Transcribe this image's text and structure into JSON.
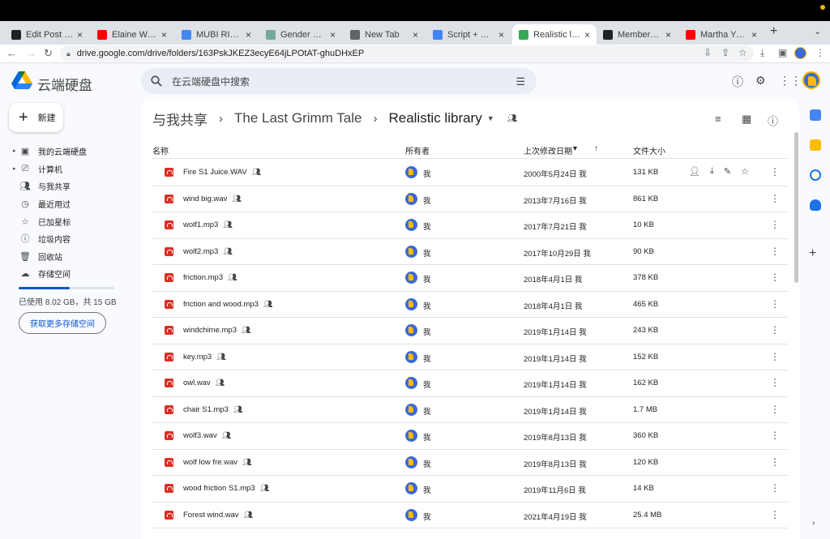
{
  "browser": {
    "tabs": [
      {
        "label": "Edit Post *AR Ti",
        "favicon": "black-square-icon",
        "color": "#202124"
      },
      {
        "label": "Elaine Wah - Yo",
        "favicon": "youtube-icon",
        "color": "#ff0000"
      },
      {
        "label": "MUBI RIDING Hi",
        "favicon": "google-icon",
        "color": "#4285f4"
      },
      {
        "label": "Gender Dynami",
        "favicon": "chatgpt-icon",
        "color": "#74aa9c"
      },
      {
        "label": "New Tab",
        "favicon": "chrome-icon",
        "color": "#5f6368"
      },
      {
        "label": "Script + Sound",
        "favicon": "docs-icon",
        "color": "#4285f4"
      },
      {
        "label": "Realistic library",
        "favicon": "drive-icon",
        "color": "#34a853"
      },
      {
        "label": "Members – myt",
        "favicon": "black-square-icon",
        "color": "#202124"
      },
      {
        "label": "Martha Yuill - Yo",
        "favicon": "youtube-icon",
        "color": "#ff0000"
      }
    ],
    "url": "drive.google.com/drive/folders/163PskJKEZ3ecyE64jLPOtAT-ghuDHxEP"
  },
  "header": {
    "brand": "云端硬盘",
    "search_placeholder": "在云端硬盘中搜索"
  },
  "sidebar": {
    "new_label": "新建",
    "items": [
      {
        "label": "我的云端硬盘",
        "icon": "my-drive-icon",
        "expandable": true
      },
      {
        "label": "计算机",
        "icon": "computer-icon",
        "expandable": true
      },
      {
        "label": "与我共享",
        "icon": "shared-with-me-icon",
        "expandable": false
      },
      {
        "label": "最近用过",
        "icon": "recent-icon",
        "expandable": false
      },
      {
        "label": "已加星标",
        "icon": "star-icon",
        "expandable": false
      },
      {
        "label": "垃圾内容",
        "icon": "spam-icon",
        "expandable": false
      },
      {
        "label": "回收站",
        "icon": "trash-icon",
        "expandable": false
      },
      {
        "label": "存储空间",
        "icon": "cloud-icon",
        "expandable": false
      }
    ],
    "storage_text": "已使用 8.02 GB，共 15 GB",
    "storage_fraction": 0.535,
    "get_more_label": "获取更多存储空间"
  },
  "breadcrumb": {
    "items": [
      "与我共享",
      "The Last Grimm Tale",
      "Realistic library"
    ]
  },
  "table": {
    "headers": {
      "name": "名称",
      "owner": "所有者",
      "modified": "上次修改日期",
      "size": "文件大小"
    },
    "rows": [
      {
        "name": "Fire S1 Juice.WAV",
        "owner": "我",
        "modified": "2000年5月24日 我",
        "size": "131 KB"
      },
      {
        "name": "wind big.wav",
        "owner": "我",
        "modified": "2013年7月16日 我",
        "size": "861 KB"
      },
      {
        "name": "wolf1.mp3",
        "owner": "我",
        "modified": "2017年7月21日 我",
        "size": "10 KB"
      },
      {
        "name": "wolf2.mp3",
        "owner": "我",
        "modified": "2017年10月29日 我",
        "size": "90 KB"
      },
      {
        "name": "friction.mp3",
        "owner": "我",
        "modified": "2018年4月1日 我",
        "size": "378 KB"
      },
      {
        "name": "friction and wood.mp3",
        "owner": "我",
        "modified": "2018年4月1日 我",
        "size": "465 KB"
      },
      {
        "name": "windchime.mp3",
        "owner": "我",
        "modified": "2019年1月14日 我",
        "size": "243 KB"
      },
      {
        "name": "key.mp3",
        "owner": "我",
        "modified": "2019年1月14日 我",
        "size": "152 KB"
      },
      {
        "name": "owl.wav",
        "owner": "我",
        "modified": "2019年1月14日 我",
        "size": "162 KB"
      },
      {
        "name": "chair S1.mp3",
        "owner": "我",
        "modified": "2019年1月14日 我",
        "size": "1.7 MB"
      },
      {
        "name": "wolf3.wav",
        "owner": "我",
        "modified": "2019年8月13日 我",
        "size": "360 KB"
      },
      {
        "name": "wolf low fre.wav",
        "owner": "我",
        "modified": "2019年8月13日 我",
        "size": "120 KB"
      },
      {
        "name": "wood friction S1.mp3",
        "owner": "我",
        "modified": "2019年11月6日 我",
        "size": "14 KB"
      },
      {
        "name": "Forest wind.wav",
        "owner": "我",
        "modified": "2021年4月19日 我",
        "size": "25.4 MB"
      }
    ]
  },
  "colors": {
    "accent": "#0b57d0",
    "file_icon": "#d93025"
  }
}
